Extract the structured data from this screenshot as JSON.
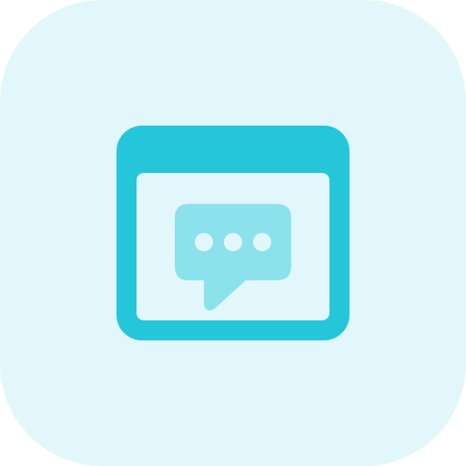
{
  "icon": {
    "name": "browser-chat-icon",
    "colors": {
      "tile_background": "#E2F7FB",
      "window_frame": "#26C6DA",
      "window_body": "#E2F7FB",
      "speech_bubble": "#8BE2EC",
      "dots": "#E2F7FB"
    }
  }
}
